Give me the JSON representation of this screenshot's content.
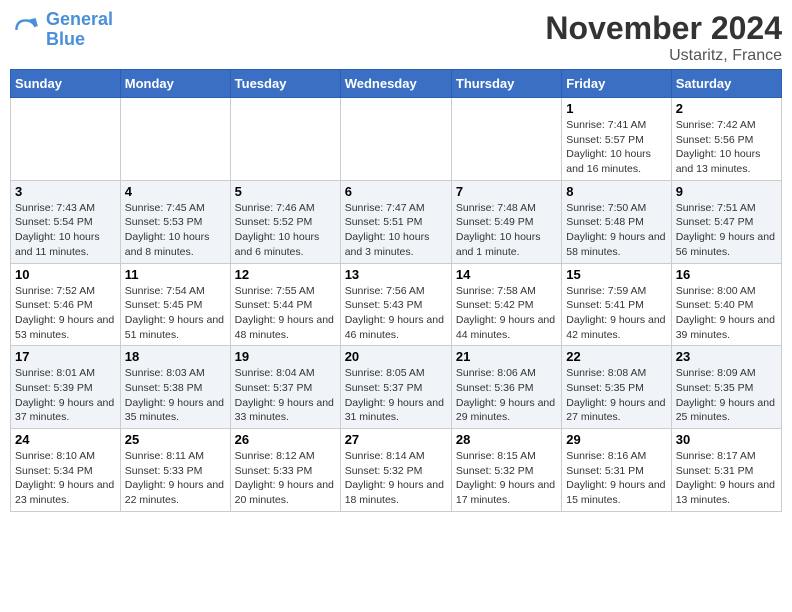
{
  "header": {
    "logo_general": "General",
    "logo_blue": "Blue",
    "month_title": "November 2024",
    "location": "Ustaritz, France"
  },
  "days_of_week": [
    "Sunday",
    "Monday",
    "Tuesday",
    "Wednesday",
    "Thursday",
    "Friday",
    "Saturday"
  ],
  "weeks": [
    [
      {
        "day": "",
        "info": ""
      },
      {
        "day": "",
        "info": ""
      },
      {
        "day": "",
        "info": ""
      },
      {
        "day": "",
        "info": ""
      },
      {
        "day": "",
        "info": ""
      },
      {
        "day": "1",
        "info": "Sunrise: 7:41 AM\nSunset: 5:57 PM\nDaylight: 10 hours and 16 minutes."
      },
      {
        "day": "2",
        "info": "Sunrise: 7:42 AM\nSunset: 5:56 PM\nDaylight: 10 hours and 13 minutes."
      }
    ],
    [
      {
        "day": "3",
        "info": "Sunrise: 7:43 AM\nSunset: 5:54 PM\nDaylight: 10 hours and 11 minutes."
      },
      {
        "day": "4",
        "info": "Sunrise: 7:45 AM\nSunset: 5:53 PM\nDaylight: 10 hours and 8 minutes."
      },
      {
        "day": "5",
        "info": "Sunrise: 7:46 AM\nSunset: 5:52 PM\nDaylight: 10 hours and 6 minutes."
      },
      {
        "day": "6",
        "info": "Sunrise: 7:47 AM\nSunset: 5:51 PM\nDaylight: 10 hours and 3 minutes."
      },
      {
        "day": "7",
        "info": "Sunrise: 7:48 AM\nSunset: 5:49 PM\nDaylight: 10 hours and 1 minute."
      },
      {
        "day": "8",
        "info": "Sunrise: 7:50 AM\nSunset: 5:48 PM\nDaylight: 9 hours and 58 minutes."
      },
      {
        "day": "9",
        "info": "Sunrise: 7:51 AM\nSunset: 5:47 PM\nDaylight: 9 hours and 56 minutes."
      }
    ],
    [
      {
        "day": "10",
        "info": "Sunrise: 7:52 AM\nSunset: 5:46 PM\nDaylight: 9 hours and 53 minutes."
      },
      {
        "day": "11",
        "info": "Sunrise: 7:54 AM\nSunset: 5:45 PM\nDaylight: 9 hours and 51 minutes."
      },
      {
        "day": "12",
        "info": "Sunrise: 7:55 AM\nSunset: 5:44 PM\nDaylight: 9 hours and 48 minutes."
      },
      {
        "day": "13",
        "info": "Sunrise: 7:56 AM\nSunset: 5:43 PM\nDaylight: 9 hours and 46 minutes."
      },
      {
        "day": "14",
        "info": "Sunrise: 7:58 AM\nSunset: 5:42 PM\nDaylight: 9 hours and 44 minutes."
      },
      {
        "day": "15",
        "info": "Sunrise: 7:59 AM\nSunset: 5:41 PM\nDaylight: 9 hours and 42 minutes."
      },
      {
        "day": "16",
        "info": "Sunrise: 8:00 AM\nSunset: 5:40 PM\nDaylight: 9 hours and 39 minutes."
      }
    ],
    [
      {
        "day": "17",
        "info": "Sunrise: 8:01 AM\nSunset: 5:39 PM\nDaylight: 9 hours and 37 minutes."
      },
      {
        "day": "18",
        "info": "Sunrise: 8:03 AM\nSunset: 5:38 PM\nDaylight: 9 hours and 35 minutes."
      },
      {
        "day": "19",
        "info": "Sunrise: 8:04 AM\nSunset: 5:37 PM\nDaylight: 9 hours and 33 minutes."
      },
      {
        "day": "20",
        "info": "Sunrise: 8:05 AM\nSunset: 5:37 PM\nDaylight: 9 hours and 31 minutes."
      },
      {
        "day": "21",
        "info": "Sunrise: 8:06 AM\nSunset: 5:36 PM\nDaylight: 9 hours and 29 minutes."
      },
      {
        "day": "22",
        "info": "Sunrise: 8:08 AM\nSunset: 5:35 PM\nDaylight: 9 hours and 27 minutes."
      },
      {
        "day": "23",
        "info": "Sunrise: 8:09 AM\nSunset: 5:35 PM\nDaylight: 9 hours and 25 minutes."
      }
    ],
    [
      {
        "day": "24",
        "info": "Sunrise: 8:10 AM\nSunset: 5:34 PM\nDaylight: 9 hours and 23 minutes."
      },
      {
        "day": "25",
        "info": "Sunrise: 8:11 AM\nSunset: 5:33 PM\nDaylight: 9 hours and 22 minutes."
      },
      {
        "day": "26",
        "info": "Sunrise: 8:12 AM\nSunset: 5:33 PM\nDaylight: 9 hours and 20 minutes."
      },
      {
        "day": "27",
        "info": "Sunrise: 8:14 AM\nSunset: 5:32 PM\nDaylight: 9 hours and 18 minutes."
      },
      {
        "day": "28",
        "info": "Sunrise: 8:15 AM\nSunset: 5:32 PM\nDaylight: 9 hours and 17 minutes."
      },
      {
        "day": "29",
        "info": "Sunrise: 8:16 AM\nSunset: 5:31 PM\nDaylight: 9 hours and 15 minutes."
      },
      {
        "day": "30",
        "info": "Sunrise: 8:17 AM\nSunset: 5:31 PM\nDaylight: 9 hours and 13 minutes."
      }
    ]
  ]
}
